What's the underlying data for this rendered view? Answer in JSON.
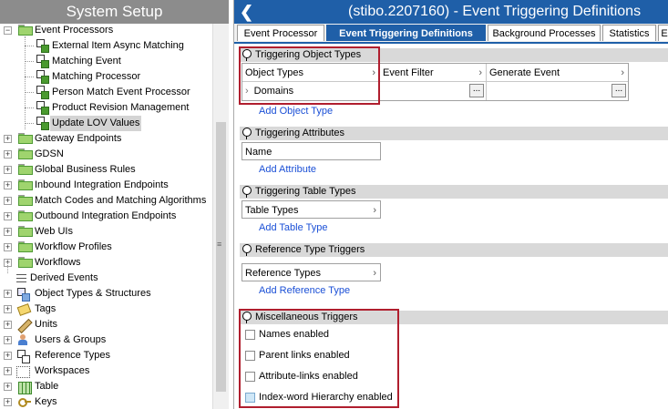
{
  "left": {
    "title": "System Setup",
    "event_processors": "Event Processors",
    "children": [
      "External Item Async Matching",
      "Matching Event",
      "Matching Processor",
      "Person Match Event Processor",
      "Product Revision Management",
      "Update LOV Values"
    ],
    "nodes": [
      "Gateway Endpoints",
      "GDSN",
      "Global Business Rules",
      "Inbound Integration Endpoints",
      "Match Codes and Matching Algorithms",
      "Outbound Integration Endpoints",
      "Web UIs",
      "Workflow Profiles",
      "Workflows",
      "Derived Events",
      "Object Types & Structures",
      "Tags",
      "Units",
      "Users & Groups",
      "Reference Types",
      "Workspaces",
      "Table",
      "Keys"
    ]
  },
  "right": {
    "title": "(stibo.2207160) - Event Triggering Definitions",
    "tabs": [
      "Event Processor",
      "Event Triggering Definitions",
      "Background Processes",
      "Statistics",
      "E"
    ],
    "s1": {
      "title": "Triggering Object Types",
      "cols": [
        "Object Types",
        "Event Filter",
        "Generate Event"
      ],
      "row": "Domains",
      "link": "Add Object Type"
    },
    "s2": {
      "title": "Triggering Attributes",
      "col": "Name",
      "link": "Add Attribute"
    },
    "s3": {
      "title": "Triggering Table Types",
      "col": "Table Types",
      "link": "Add Table Type"
    },
    "s4": {
      "title": "Reference Type Triggers",
      "col": "Reference Types",
      "link": "Add Reference Type"
    },
    "s5": {
      "title": "Miscellaneous Triggers",
      "checks": [
        "Names enabled",
        "Parent links enabled",
        "Attribute-links enabled",
        "Index-word Hierarchy enabled"
      ]
    }
  }
}
